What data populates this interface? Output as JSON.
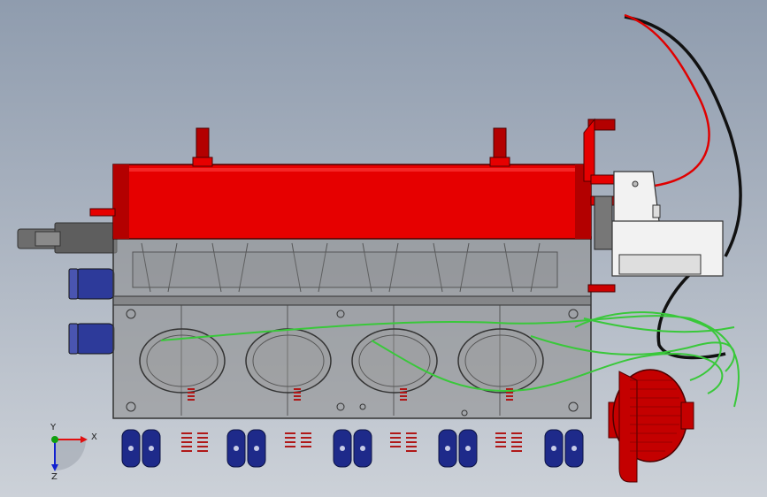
{
  "viewport": {
    "background_top": "#8f9cae",
    "background_bottom": "#ccd1d8"
  },
  "model": {
    "head_color": "#e60000",
    "head_dark": "#b30000",
    "block_color": "#8c8c8c",
    "cap_color": "#1e2a8a",
    "spring_color": "#b01818",
    "wire_green": "#39c83a",
    "wire_red": "#e00000",
    "wire_black": "#111111",
    "motor_color": "#f2f2f2",
    "pump_color": "#c40000",
    "fitting_color": "#2d3a9a",
    "bolt_color": "#555555"
  },
  "triad": {
    "x_label": "X",
    "y_label": "Y",
    "z_label": "Z",
    "x_color": "#e01010",
    "y_color": "#10a010",
    "z_color": "#1020d0"
  }
}
